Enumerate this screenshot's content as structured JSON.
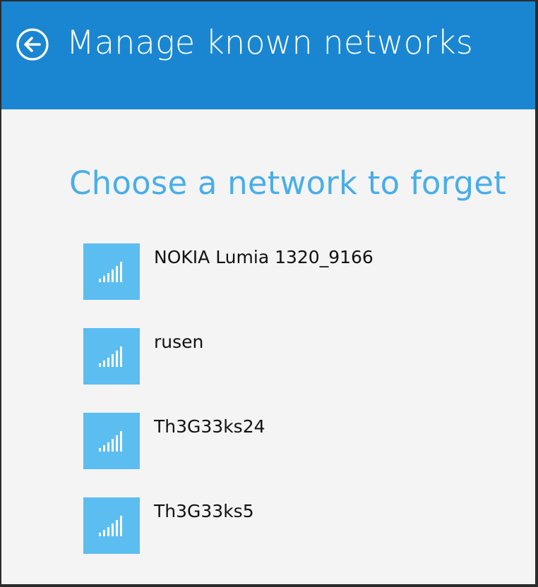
{
  "header": {
    "title": "Manage known networks",
    "back_icon": "back-arrow-circle-icon",
    "color": "#1a86d2"
  },
  "main": {
    "heading": "Choose a network to forget",
    "heading_color": "#49aee8",
    "networks": [
      {
        "name": "NOKIA Lumia 1320_9166",
        "icon": "wifi-signal-icon"
      },
      {
        "name": "rusen",
        "icon": "wifi-signal-icon"
      },
      {
        "name": "Th3G33ks24",
        "icon": "wifi-signal-icon"
      },
      {
        "name": "Th3G33ks5",
        "icon": "wifi-signal-icon"
      }
    ],
    "tile_color": "#5cbdf1"
  }
}
